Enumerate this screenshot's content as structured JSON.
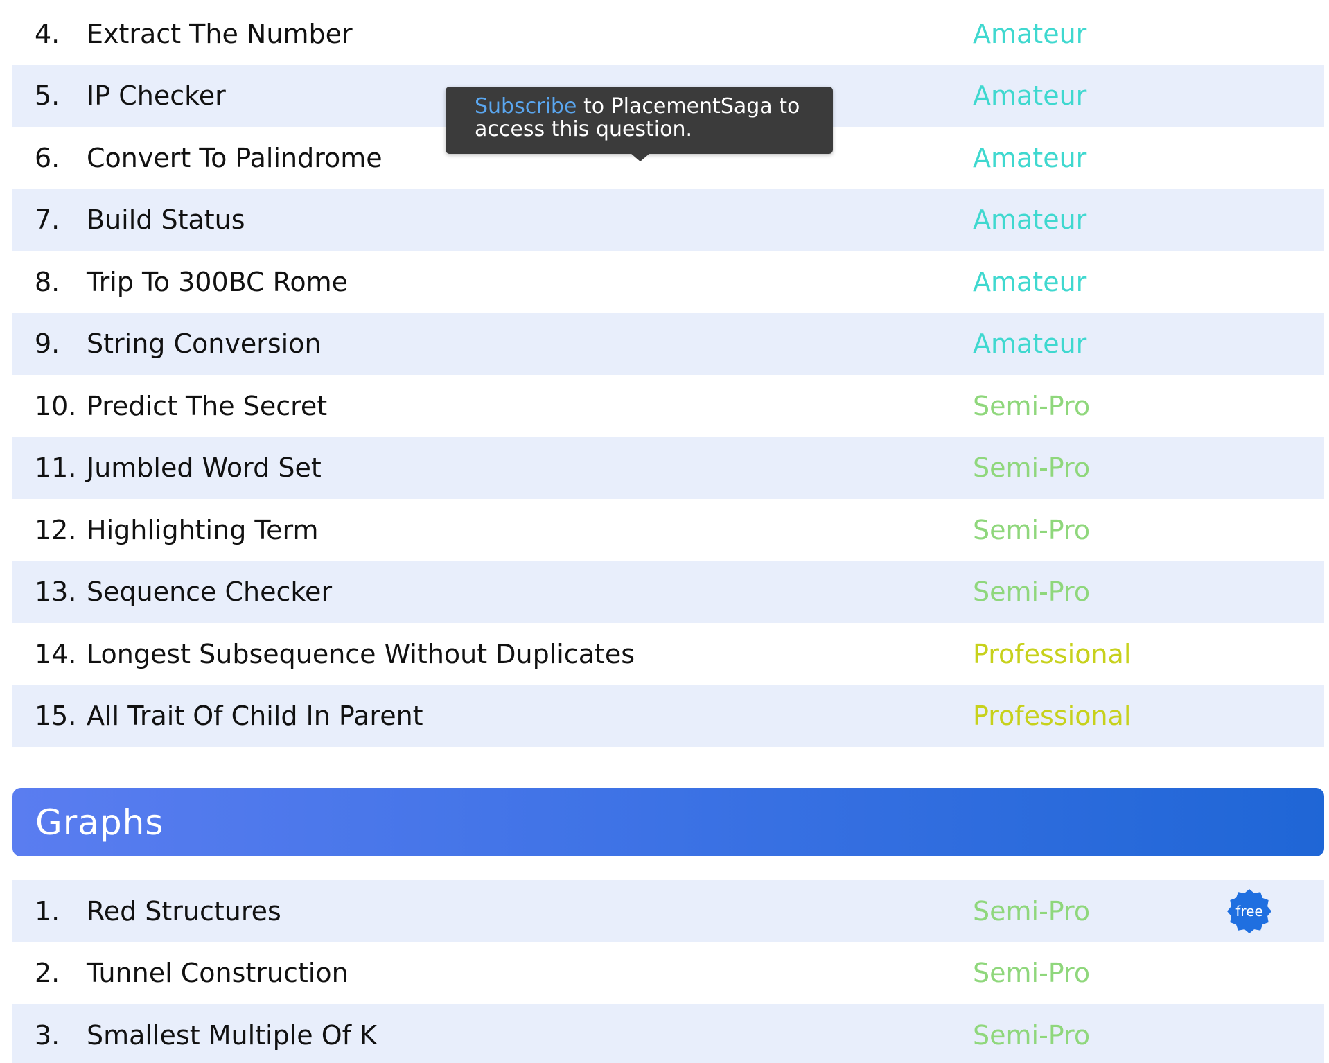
{
  "colors": {
    "amateur": "#3fd8cf",
    "semi_pro": "#8fd77c",
    "professional": "#c7d11c",
    "link": "#5aa6ef",
    "badge": "#1f6fe0"
  },
  "tooltip": {
    "link_text": "Subscribe",
    "text_line1": " to PlacementSaga to",
    "text_line2": "access this question."
  },
  "strings_list": [
    {
      "number": "4.",
      "title": "Extract The Number",
      "level": "Amateur",
      "level_key": "amateur"
    },
    {
      "number": "5.",
      "title": "IP Checker",
      "level": "Amateur",
      "level_key": "amateur"
    },
    {
      "number": "6.",
      "title": "Convert To Palindrome",
      "level": "Amateur",
      "level_key": "amateur"
    },
    {
      "number": "7.",
      "title": "Build Status",
      "level": "Amateur",
      "level_key": "amateur"
    },
    {
      "number": "8.",
      "title": "Trip To 300BC Rome",
      "level": "Amateur",
      "level_key": "amateur"
    },
    {
      "number": "9.",
      "title": "String Conversion",
      "level": "Amateur",
      "level_key": "amateur"
    },
    {
      "number": "10.",
      "title": "Predict The Secret",
      "level": "Semi-Pro",
      "level_key": "semi_pro"
    },
    {
      "number": "11.",
      "title": "Jumbled Word Set",
      "level": "Semi-Pro",
      "level_key": "semi_pro"
    },
    {
      "number": "12.",
      "title": "Highlighting Term",
      "level": "Semi-Pro",
      "level_key": "semi_pro"
    },
    {
      "number": "13.",
      "title": "Sequence Checker",
      "level": "Semi-Pro",
      "level_key": "semi_pro"
    },
    {
      "number": "14.",
      "title": "Longest Subsequence Without Duplicates",
      "level": "Professional",
      "level_key": "professional"
    },
    {
      "number": "15.",
      "title": "All Trait Of Child In Parent",
      "level": "Professional",
      "level_key": "professional"
    }
  ],
  "graphs_section": {
    "title": "Graphs",
    "items": [
      {
        "number": "1.",
        "title": "Red Structures",
        "level": "Semi-Pro",
        "level_key": "semi_pro",
        "badge": "free"
      },
      {
        "number": "2.",
        "title": "Tunnel Construction",
        "level": "Semi-Pro",
        "level_key": "semi_pro"
      },
      {
        "number": "3.",
        "title": "Smallest Multiple Of K",
        "level": "Semi-Pro",
        "level_key": "semi_pro"
      }
    ]
  },
  "icons": {
    "free_badge": "free-badge-icon"
  }
}
